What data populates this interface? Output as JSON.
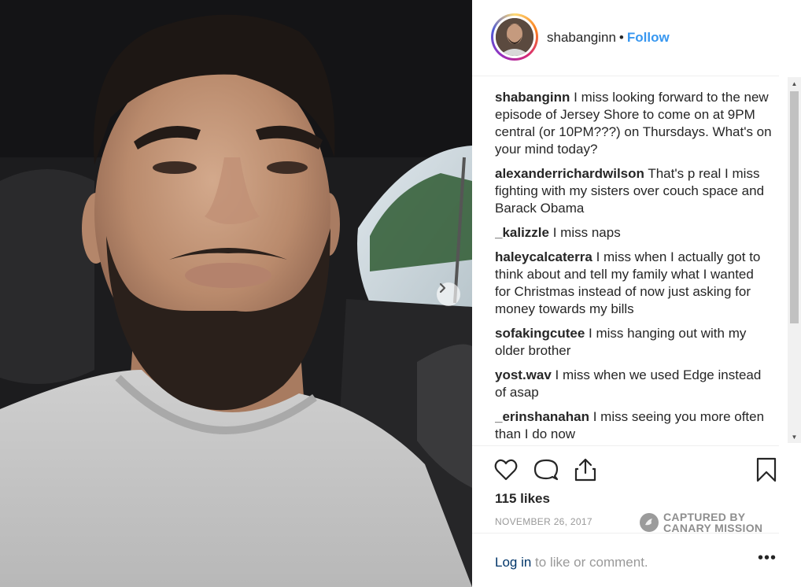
{
  "post": {
    "username": "shabanginn",
    "follow_label": "Follow",
    "separator": "•"
  },
  "comments": [
    {
      "user": "shabanginn",
      "text": "I miss looking forward to the new episode of Jersey Shore to come on at 9PM central (or 10PM???) on Thursdays. What's on your mind today?"
    },
    {
      "user": "alexanderrichardwilson",
      "text": "That's p real I miss fighting with my sisters over couch space and Barack Obama"
    },
    {
      "user": "_kalizzle",
      "text": "I miss naps"
    },
    {
      "user": "haleycalcaterra",
      "text": "I miss when I actually got to think about and tell my family what I wanted for Christmas instead of now just asking for money towards my bills"
    },
    {
      "user": "sofakingcutee",
      "text": "I miss hanging out with my older brother"
    },
    {
      "user": "yost.wav",
      "text": "I miss when we used Edge instead of asap"
    },
    {
      "user": "_erinshanahan",
      "text": "I miss seeing you more often than I do now"
    }
  ],
  "engagement": {
    "likes": "115 likes",
    "date": "NOVEMBER 26, 2017"
  },
  "watermark": {
    "line1": "CAPTURED BY",
    "line2": "CANARY MISSION"
  },
  "login": {
    "link": "Log in",
    "rest": " to like or comment.",
    "more": "•••"
  },
  "icons": {
    "like": "heart-icon",
    "comment": "comment-icon",
    "share": "share-icon",
    "save": "bookmark-icon",
    "next": "chevron-right-icon"
  },
  "colors": {
    "follow": "#3897f0",
    "login_link": "#003569",
    "muted": "#999999"
  }
}
